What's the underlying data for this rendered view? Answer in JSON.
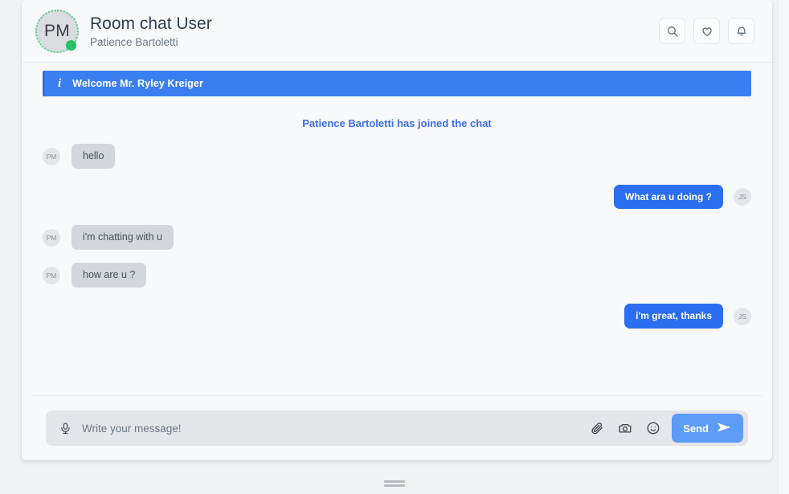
{
  "header": {
    "avatar_initials": "PM",
    "avatar_status": "online",
    "title": "Room chat User",
    "subtitle": "Patience Bartoletti",
    "actions": [
      {
        "name": "search-icon",
        "label": "Search"
      },
      {
        "name": "heart-icon",
        "label": "Favorite"
      },
      {
        "name": "bell-icon",
        "label": "Notifications"
      }
    ]
  },
  "alert": {
    "icon": "info-icon",
    "glyph": "i",
    "text": "Welcome Mr. Ryley Kreiger",
    "color": "#3b7ef1"
  },
  "system_message": "Patience Bartoletti has joined the chat",
  "messages": [
    {
      "direction": "incoming",
      "avatar": "PM",
      "text": "hello"
    },
    {
      "direction": "outgoing",
      "avatar": "JS",
      "text": "What ara u doing ?"
    },
    {
      "direction": "incoming",
      "avatar": "PM",
      "text": "i'm chatting with u"
    },
    {
      "direction": "incoming",
      "avatar": "PM",
      "text": "how are u ?"
    },
    {
      "direction": "outgoing",
      "avatar": "JS",
      "text": "i'm great, thanks"
    }
  ],
  "composer": {
    "mic_icon": "microphone-icon",
    "placeholder": "Write your message!",
    "value": "",
    "attach_icon": "paperclip-icon",
    "camera_icon": "camera-icon",
    "emoji_icon": "smiley-icon",
    "send_label": "Send",
    "send_icon": "send-arrow-icon",
    "send_color": "#5d9cf7"
  },
  "colors": {
    "accent_blue": "#2b6ef0",
    "banner_blue": "#3b7ef1",
    "bubble_gray": "#d3d6db",
    "online_green": "#25c167"
  }
}
